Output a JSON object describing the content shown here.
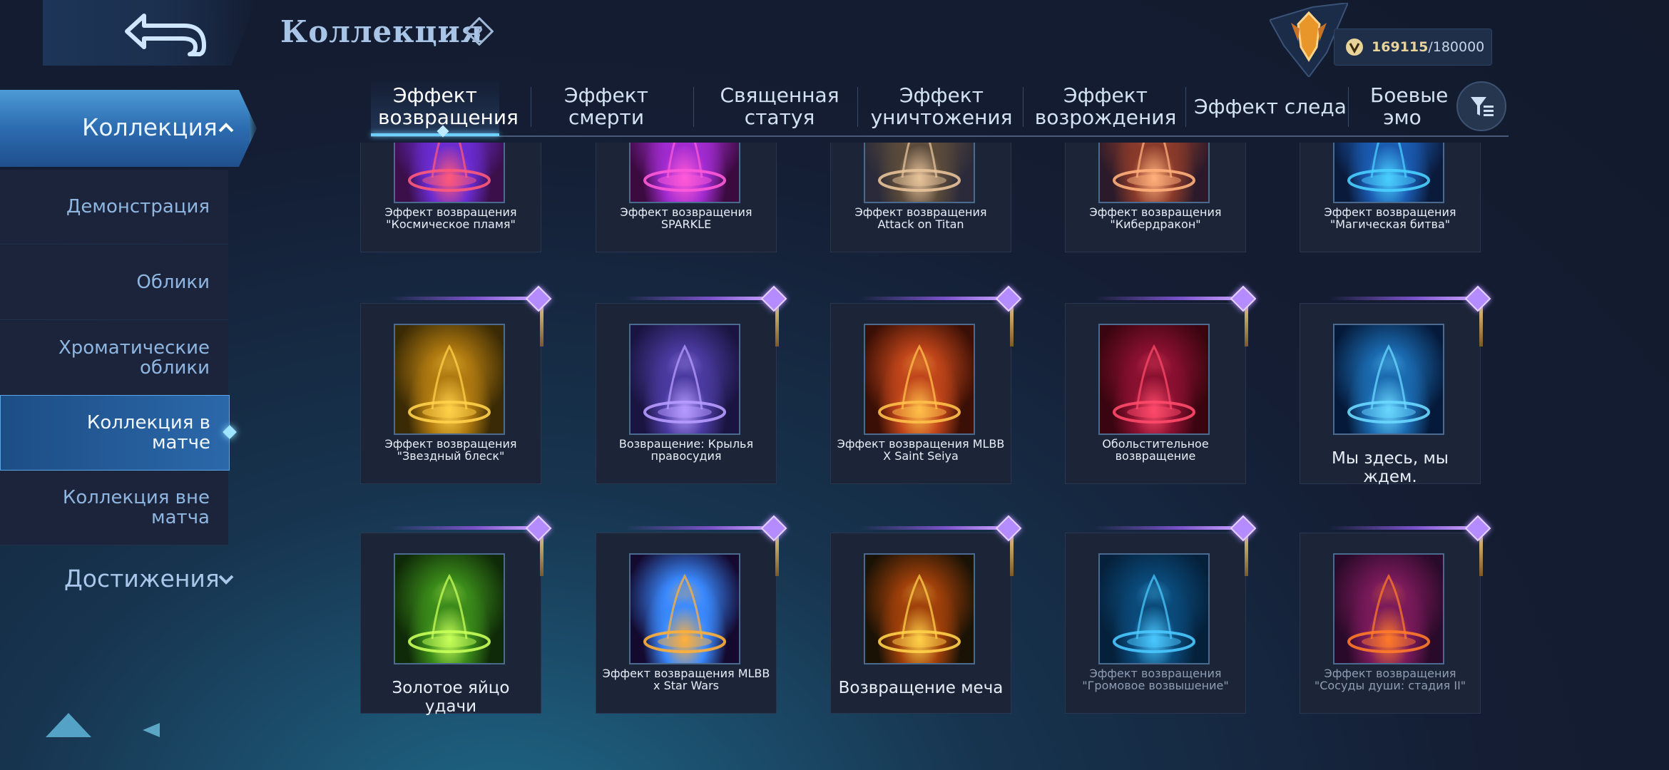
{
  "header": {
    "title": "Коллекция",
    "points_current": "169115",
    "points_max": "/180000"
  },
  "sidebar": {
    "main_label": "Коллекция",
    "items": [
      {
        "label": "Демонстрация"
      },
      {
        "label": "Облики"
      },
      {
        "label": "Хроматические облики"
      },
      {
        "label": "Коллекция в матче",
        "active": true
      },
      {
        "label": "Коллекция вне матча"
      }
    ],
    "achievements_label": "Достижения"
  },
  "tabs": [
    {
      "label": "Эффект возвращения",
      "active": true
    },
    {
      "label": "Эффект смерти"
    },
    {
      "label": "Священная статуя"
    },
    {
      "label": "Эффект уничтожения"
    },
    {
      "label": "Эффект возрождения"
    },
    {
      "label": "Эффект следа"
    },
    {
      "label": "Боевые эмо"
    }
  ],
  "cards": [
    {
      "caption": "Эффект возвращения \"Космическое пламя\"",
      "colors": [
        "#3a0f4a",
        "#ff5a7a",
        "#6a2bd0"
      ]
    },
    {
      "caption": "Эффект возвращения SPARKLE",
      "colors": [
        "#3b0a3f",
        "#ff5ad8",
        "#a12bd0"
      ]
    },
    {
      "caption": "Эффект возвращения Attack on Titan",
      "colors": [
        "#2a2a3a",
        "#e8c39a",
        "#5a4a3a"
      ]
    },
    {
      "caption": "Эффект возвращения \"Кибердракон\"",
      "colors": [
        "#2a1a2a",
        "#ffb07a",
        "#8a3a2a"
      ]
    },
    {
      "caption": "Эффект возвращения \"Магическая битва\"",
      "colors": [
        "#0a1a3a",
        "#4ad0ff",
        "#1a5ab0"
      ]
    },
    {
      "caption": "Эффект возвращения \"Звездный блеск\"",
      "colors": [
        "#3a2a05",
        "#ffd24a",
        "#b07a10"
      ]
    },
    {
      "caption": "Возвращение: Крылья правосудия",
      "colors": [
        "#1a1440",
        "#b79cff",
        "#4a3aa0"
      ]
    },
    {
      "caption": "Эффект возвращения MLBB X Saint Seiya",
      "colors": [
        "#3a0f05",
        "#ffc04a",
        "#c0451a"
      ]
    },
    {
      "caption": "Обольстительное возвращение",
      "colors": [
        "#3a0510",
        "#ff4a6a",
        "#8a1030"
      ]
    },
    {
      "caption": "Мы здесь, мы ждем.",
      "big": true,
      "colors": [
        "#051a3a",
        "#6ad8ff",
        "#1a6ab0"
      ]
    },
    {
      "caption": "Золотое яйцо удачи",
      "big": true,
      "colors": [
        "#0f2a08",
        "#c8ff5a",
        "#3a8a1a"
      ]
    },
    {
      "caption": "Эффект возвращения MLBB x Star Wars",
      "colors": [
        "#140a30",
        "#ffb03a",
        "#3a8aff"
      ]
    },
    {
      "caption": "Возвращение меча",
      "big": true,
      "colors": [
        "#1a1205",
        "#ffd04a",
        "#a0400a"
      ]
    },
    {
      "caption": "Эффект возвращения \"Громовое возвышение\"",
      "locked": true,
      "colors": [
        "#05203a",
        "#4ac8ff",
        "#0a4a7a"
      ]
    },
    {
      "caption": "Эффект возвращения \"Сосуды души: стадия II\"",
      "locked": true,
      "colors": [
        "#2a0a2a",
        "#ff7a2a",
        "#7a1a5a"
      ]
    }
  ]
}
